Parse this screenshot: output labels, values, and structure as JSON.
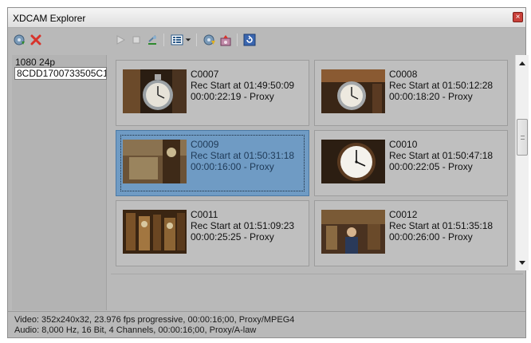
{
  "window": {
    "title": "XDCAM Explorer",
    "close_glyph": "×"
  },
  "toolbar": {
    "icons": [
      "import-icon",
      "delete-icon",
      "play-icon",
      "stop-icon",
      "eject-icon",
      "view-mode-icon",
      "dropdown-arrow-icon",
      "import-to-project-icon",
      "export-icon",
      "refresh-icon"
    ]
  },
  "tree": {
    "format": "1080 24p",
    "disc_id": "8CDD1700733505C1"
  },
  "clips": [
    {
      "name": "C0007",
      "rec": "Rec Start at 01:49:50:09",
      "dur": "00:00:22:19 - Proxy",
      "selected": false
    },
    {
      "name": "C0008",
      "rec": "Rec Start at 01:50:12:28",
      "dur": "00:00:18:20 - Proxy",
      "selected": false
    },
    {
      "name": "C0009",
      "rec": "Rec Start at 01:50:31:18",
      "dur": "00:00:16:00 - Proxy",
      "selected": true
    },
    {
      "name": "C0010",
      "rec": "Rec Start at 01:50:47:18",
      "dur": "00:00:22:05 - Proxy",
      "selected": false
    },
    {
      "name": "C0011",
      "rec": "Rec Start at 01:51:09:23",
      "dur": "00:00:25:25 - Proxy",
      "selected": false
    },
    {
      "name": "C0012",
      "rec": "Rec Start at 01:51:35:18",
      "dur": "00:00:26:00 - Proxy",
      "selected": false
    }
  ],
  "status": {
    "video": "Video: 352x240x32, 23.976 fps progressive, 00:00:16;00, Proxy/MPEG4",
    "audio": "Audio: 8,000 Hz, 16 Bit, 4 Channels, 00:00:16;00, Proxy/A-law"
  },
  "colors": {
    "selection": "#6f9bc4",
    "background": "#b9b9b9",
    "delete": "#d8332b"
  }
}
